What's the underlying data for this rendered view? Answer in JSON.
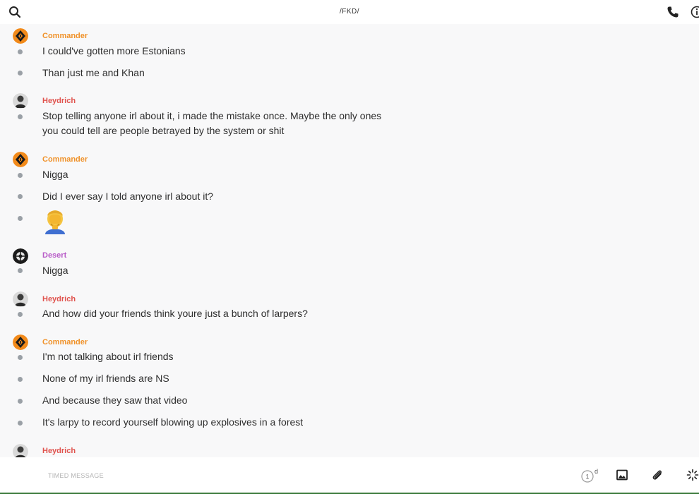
{
  "header": {
    "title": "/FKD/"
  },
  "messages": [
    {
      "sender": "Commander",
      "color": "#f0922a",
      "avatar": "commander-avatar",
      "texts": [
        "I could've gotten more Estonians",
        "Than just me and Khan"
      ]
    },
    {
      "sender": "Heydrich",
      "color": "#e0524d",
      "avatar": "heydrich-avatar",
      "texts": [
        "Stop telling anyone irl about it, i made the mistake once. Maybe the only ones you could tell are people betrayed by the system or shit"
      ]
    },
    {
      "sender": "Commander",
      "color": "#f0922a",
      "avatar": "commander-avatar",
      "texts": [
        "Nigga",
        "Did I ever say I told anyone irl about it?"
      ],
      "emoji": "face-palm-emoji"
    },
    {
      "sender": "Desert",
      "color": "#b85cc8",
      "avatar": "desert-avatar",
      "texts": [
        "Nigga"
      ]
    },
    {
      "sender": "Heydrich",
      "color": "#e0524d",
      "avatar": "heydrich-avatar",
      "texts": [
        "And how did your friends think youre just a bunch of larpers?"
      ]
    },
    {
      "sender": "Commander",
      "color": "#f0922a",
      "avatar": "commander-avatar",
      "texts": [
        "I'm not talking about irl friends",
        "None of my irl friends are NS",
        "And because they saw that video",
        "It's larpy to record yourself blowing up explosives in a forest"
      ]
    },
    {
      "sender": "Heydrich",
      "color": "#e0524d",
      "avatar": "heydrich-avatar",
      "texts": []
    }
  ],
  "composer": {
    "placeholder": "TIMED MESSAGE",
    "timer_value": "1",
    "timer_unit": "d"
  }
}
